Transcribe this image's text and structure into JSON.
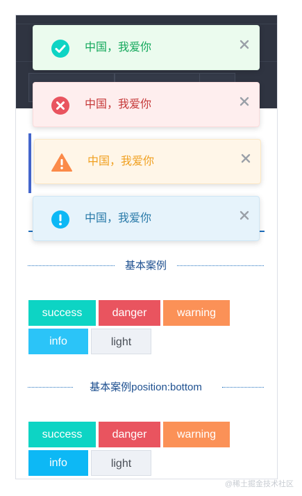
{
  "toasts": [
    {
      "type": "success",
      "message": "中国，我爱你",
      "icon": "check-circle-icon",
      "color": "#13a85b"
    },
    {
      "type": "danger",
      "message": "中国，我爱你",
      "icon": "x-circle-icon",
      "color": "#e0484f"
    },
    {
      "type": "warning",
      "message": "中国，我爱你",
      "icon": "warning-triangle-icon",
      "color": "#f28a3c"
    },
    {
      "type": "info",
      "message": "中国，我爱你",
      "icon": "exclamation-circle-icon",
      "color": "#0db8f5"
    }
  ],
  "sections": [
    {
      "title": "基本案例",
      "buttons": [
        "success",
        "danger",
        "warning",
        "info",
        "light"
      ]
    },
    {
      "title": "基本案例position:bottom",
      "buttons": [
        "success",
        "danger",
        "warning",
        "info",
        "light"
      ]
    }
  ],
  "watermark": "@稀土掘金技术社区",
  "colors": {
    "success": "#0dd4c4",
    "danger": "#e9545f",
    "warning": "#fb9157",
    "info": "#2bc4f8",
    "light": "#eef1f6",
    "header": "#2f3441",
    "accent": "#1e6fbd"
  }
}
